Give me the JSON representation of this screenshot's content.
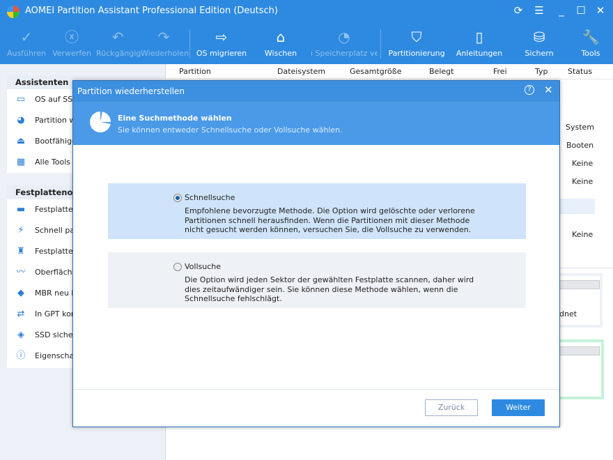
{
  "app": {
    "title": "AOMEI Partition Assistant Professional Edition (Deutsch)"
  },
  "toolbar": [
    {
      "label": "Ausführen",
      "icon": "check-icon",
      "enabled": false
    },
    {
      "label": "Verwerfen",
      "icon": "discard-icon",
      "enabled": false
    },
    {
      "label": "Rückgängig",
      "icon": "undo-icon",
      "enabled": false
    },
    {
      "label": "Wiederholen",
      "icon": "redo-icon",
      "enabled": false
    },
    {
      "label": "OS migrieren",
      "icon": "migrate-os-icon",
      "enabled": true
    },
    {
      "label": "Wischen",
      "icon": "wipe-icon",
      "enabled": true
    },
    {
      "label": "ı Speicherplatz ver",
      "icon": "allocate-space-icon",
      "enabled": false
    },
    {
      "label": "Partitionierung",
      "icon": "partition-shield-icon",
      "enabled": true
    },
    {
      "label": "Anleitungen",
      "icon": "book-icon",
      "enabled": true
    },
    {
      "label": "Sichern",
      "icon": "backup-icon",
      "enabled": true
    },
    {
      "label": "Tools",
      "icon": "wrench-icon",
      "enabled": true
    }
  ],
  "sidebar": {
    "sections": [
      {
        "title": "Assistenten",
        "items": [
          "OS auf SSD",
          "Partition wie",
          "Bootfähiges",
          "Alle Tools"
        ]
      },
      {
        "title": "Festplattenope",
        "items": [
          "Festplatte k",
          "Schnell part",
          "Festplatte b",
          "Oberfläche",
          "MBR neu bil",
          "In GPT konv",
          "SSD sicher l",
          "Eigenschaft"
        ]
      }
    ]
  },
  "table": {
    "headers": [
      "Partition",
      "Dateisystem",
      "Gesamtgröße",
      "Belegt",
      "Frei",
      "Typ",
      "Status"
    ],
    "status_values": [
      "System",
      "Booten",
      "Keine",
      "Keine",
      "Keine"
    ],
    "partial_text": "dnet"
  },
  "dialog": {
    "title": "Partition wiederherstellen",
    "heading": "Eine Suchmethode wählen",
    "subheading": "Sie können entweder Schnellsuche oder Vollsuche wählen.",
    "options": [
      {
        "label": "Schnellsuche",
        "selected": true,
        "description": "Empfohlene bevorzugte Methode. Die Option wird gelöschte oder verlorene Partitionen schnell herausfinden. Wenn die Partitionen mit dieser Methode nicht gesucht werden können, versuchen Sie, die Vollsuche zu verwenden."
      },
      {
        "label": "Vollsuche",
        "selected": false,
        "description": "Die Option wird jeden Sektor der gewählten Festplatte scannen, daher wird dies zeitaufwändiger sein. Sie können diese Methode wählen, wenn die Schnellsuche fehlschlägt."
      }
    ],
    "back_label": "Zurück",
    "next_label": "Weiter"
  }
}
